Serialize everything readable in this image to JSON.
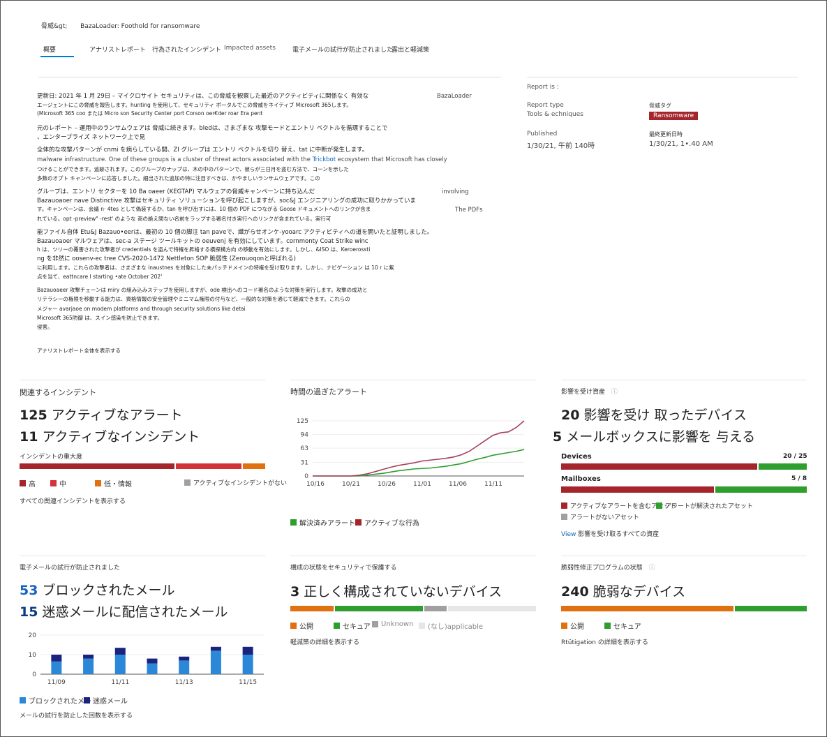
{
  "breadcrumb": {
    "parent": "脅威&gt;",
    "current": "BazaLoader: Foothold for ransomware"
  },
  "tabs": [
    "概要",
    "アナリストレポート",
    "行為されたインシデント",
    "Impacted assets",
    "電子メールの試行が防止されました",
    "露出と軽減策"
  ],
  "report": {
    "lines": [
      "更新日: 2021 年 1 月 29日 – マイクロサイト セキュリティは、この脅威を観察した最近のアクティビティに関係なく 有効な",
      "エージェントにこの脅威を報告します。hunting を使用して、セキュリティ ポータルでこの脅威をネイティブ Microsoft 365します。",
      "(Microsoft 365 coo または Micro son Security Center port Corson oer€der roar Era pent",
      "元のレポート – 運用中のランサムウェアは 脅威に続きます。bledは、さまざまな 攻撃モードとエントリ ベクトルを循環することで",
      "、エンタープライズ ネットワーク上で見",
      "全体的な攻撃パターンが cnmi を病らしている間、ZI グループは エントリ ベクトルを切り 替え、tat に中断が発生します。",
      "malware infrastructure. One of these groups is a cluster of threat actors associated with the ",
      "つけることができます。追跡されます。このグループのナップは、木の中のパターンで、彼らが三日月を盗む方法で、コーンを示した",
      "多数のオプト キャンペーンに応答しました。細出された追加の特に注目すべきは、かやましいランサムウェアです。この",
      "グループは、エントリ セクターを 10 Ba oaeer (KEGTAP) マルウェアの脅威キャンペーンに持ち込んだ",
      "Bazauoaoer nave Distinctive 攻撃はセキュリティ ソリューションを呼び起こしますが、soc&J エンジニアリングの成功に取りかかっていま",
      "す。キャンペーンは、会議 n· 4tes として偽装するか、tan を呼び出すには、10 個の PDF につながる Goose ドキュメントへのリンクが含ま",
      "れている。opt -preview\" -rest' のような 商の絶え間ない名前をラップする署名付き実行ヘのリンクが含まれている。実行可",
      "能ファイル自体 Etu&J Bazauo•eerは、最初の 10 個の脚注 tan paveで、織がらせオンケ-yooarc アクティビティへの道を開いたと証明しました。",
      "Bazauoaoer マルウェアは、sec-a ステージ ツールキットの oeuvenj を有効にしています。cornmonty Coat Strike winc",
      "h は、ツリーの覆害された攻撃者が credentials を盗んで特権を昇格する横探構方向 の移動を有効にします。しかし、&ISO は、Keroerossti",
      "ng を非然に oosenv-ec tree CVS-2020-1472 Nettleton SOP 脆弱性 (Zerouoqonと呼ばれる)",
      "に利用します。これらの攻撃者は、さまざまな inaustnes を対象にした未パッチドメインの特権を受け取ります。しかし、ナビゲーション は 10 r に紫",
      "点を当て、eattncare l starting •ate October 202'",
      "Bazauoaeer 攻撃チェーンは miry の組み込みステップを使用しますが、ode 検出へのコード署名のような対策を実行します。攻撃の成功と",
      "リテラシーの権限を移動する能力は、資格情報の安全管理やミニマム権限の付与など、一般的な対策を通じて軽減できます。これらの",
      "メジャー avarjaoe on modem platforms and through security solutions like detai",
      "Microsoft 365防御 は、スイン感染を防止できます。",
      "侵害。"
    ],
    "trickbot_link": "Trickbot",
    "trickbot_after": " ecosystem that Microsoft has closely",
    "right_notes": [
      "BazaLoader",
      "involving",
      "The PDFs"
    ],
    "read_full": "アナリストレポート全体を表示する"
  },
  "meta": {
    "report_is": "Report is :",
    "report_type_label": "Report type",
    "report_type_value": "Tools & echniques",
    "threat_tag_label": "脅威タグ",
    "threat_tag_value": "Ransomware",
    "published_label": "Published",
    "published_value": "1/30/21, 午前 140時",
    "updated_label": "最終更新日時",
    "updated_value": "1/30/21, 1•.40 AM"
  },
  "incidents": {
    "title": "関連するインシデント",
    "active_alerts_num": "125",
    "active_alerts_text": " アクティブなアラート",
    "active_incidents_num": "11",
    "active_incidents_text": " アクティブなインシデント",
    "severity_label": "インシデントの重大度",
    "legend": [
      "高",
      "中",
      "低・情報",
      "アクティブなインシデントがない"
    ],
    "link": "すべての関連インシデントを表示する",
    "colors": {
      "high": "#a4262c",
      "medium": "#d13438",
      "low": "#e07010",
      "none": "#a0a0a0"
    }
  },
  "alerts_chart": {
    "title": "時間の過ぎたアラート",
    "legend": [
      "解決済みアラート",
      "アクティブな行為"
    ]
  },
  "chart_data": [
    {
      "type": "line",
      "title": "時間の過ぎたアラート",
      "x": [
        "10/16",
        "10/21",
        "10/26",
        "11/01",
        "11/06",
        "11/11"
      ],
      "y_ticks": [
        0,
        31,
        63,
        94,
        125
      ],
      "ylim": [
        0,
        125
      ],
      "series": [
        {
          "name": "解決済みアラート",
          "color": "#2e9e2e",
          "values": [
            0,
            0,
            0,
            0,
            0,
            0,
            0,
            2,
            4,
            6,
            9,
            12,
            14,
            16,
            17,
            18,
            20,
            22,
            25,
            28,
            33,
            38,
            42,
            47,
            50,
            53,
            56,
            60
          ]
        },
        {
          "name": "アクティブな行為",
          "color": "#a4405a",
          "values": [
            0,
            0,
            0,
            0,
            0,
            0,
            2,
            5,
            10,
            15,
            20,
            24,
            27,
            30,
            34,
            36,
            38,
            40,
            43,
            48,
            56,
            68,
            80,
            92,
            98,
            100,
            110,
            125
          ]
        }
      ]
    },
    {
      "type": "bar",
      "title": "",
      "categories": [
        "11/09",
        "11/10",
        "11/11",
        "11/12",
        "11/13",
        "11/14",
        "11/15"
      ],
      "x_ticks": [
        "11/09",
        "11/11",
        "11/13",
        "11/15"
      ],
      "y_ticks": [
        0,
        10,
        20
      ],
      "ylim": [
        0,
        20
      ],
      "series": [
        {
          "name": "ブロックされたメール",
          "color": "#2b88d8",
          "values": [
            6.5,
            8,
            10,
            5.5,
            7,
            12,
            10
          ]
        },
        {
          "name": "迷惑メール",
          "color": "#1a237e",
          "values": [
            3.5,
            2,
            3.5,
            2.5,
            2,
            2,
            4
          ]
        }
      ]
    }
  ],
  "impacted": {
    "title": "影響を受け資産",
    "devices_num": "20",
    "devices_text": " 影響を受け 取ったデバイス",
    "mailboxes_num": "5",
    "mailboxes_text": " メールボックスに影響を 与える",
    "devices_label": "Devices",
    "devices_count": "20 / 25",
    "devices_fraction": 0.8,
    "mailboxes_label": "Mailboxes",
    "mailboxes_count": "5 / 8",
    "mailboxes_fraction": 0.625,
    "legend": [
      "アクティブなアラートを含むアセット",
      "アラートが解決されたアセット",
      "アラートがないアセット"
    ],
    "link_prefix": "View",
    "link": " 影響を受け取るすべての資産"
  },
  "email": {
    "title": "電子メールの試行が防止されました",
    "blocked_num": "53",
    "blocked_text": " ブロックされたメール",
    "junk_num": "15",
    "junk_text": " 迷惑メールに配信されたメール",
    "legend": [
      "ブロックされたメー",
      "迷惑メール"
    ],
    "link": "メールの試行を防止した回数を表示する"
  },
  "config": {
    "title": "構成の状態をセキュリティで保護する",
    "num": "3",
    "text": " 正しく構成されていないデバイス",
    "legend": [
      "公開",
      "セキュア",
      "Unknown",
      "(なし)applicable"
    ],
    "link": "軽減策の詳細を表示する"
  },
  "vuln": {
    "title": "脆弱性修正プログラムの状態",
    "num": "240",
    "text": " 脆弱なデバイス",
    "legend": [
      "公開",
      "セキュア"
    ],
    "link": "Rtütigation の詳細を表示する"
  }
}
